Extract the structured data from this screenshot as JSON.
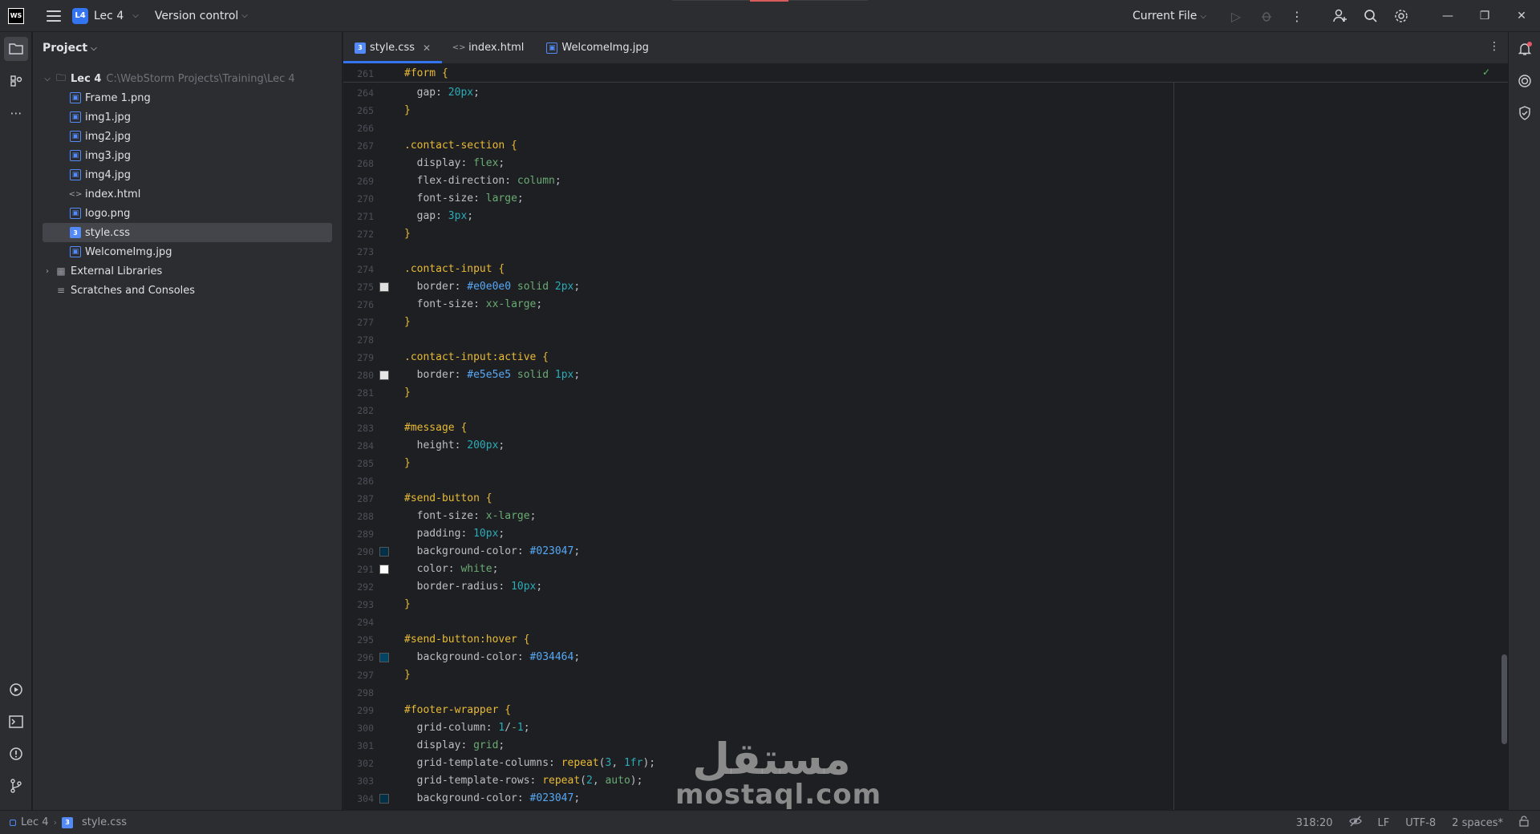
{
  "titlebar": {
    "logo_text": "WS",
    "project_badge": "L4",
    "project_name": "Lec 4",
    "vcs_label": "Version control",
    "run_config": "Current File"
  },
  "project_panel": {
    "title": "Project",
    "root_name": "Lec 4",
    "root_path": "C:\\WebStorm Projects\\Training\\Lec 4",
    "files": [
      {
        "name": "Frame 1.png",
        "kind": "img"
      },
      {
        "name": "img1.jpg",
        "kind": "img"
      },
      {
        "name": "img2.jpg",
        "kind": "img"
      },
      {
        "name": "img3.jpg",
        "kind": "img"
      },
      {
        "name": "img4.jpg",
        "kind": "img"
      },
      {
        "name": "index.html",
        "kind": "html"
      },
      {
        "name": "logo.png",
        "kind": "img"
      },
      {
        "name": "style.css",
        "kind": "css",
        "selected": true
      },
      {
        "name": "WelcomeImg.jpg",
        "kind": "img"
      }
    ],
    "external_libraries": "External Libraries",
    "scratches": "Scratches and Consoles"
  },
  "tabs": [
    {
      "label": "style.css",
      "kind": "css",
      "active": true
    },
    {
      "label": "index.html",
      "kind": "html"
    },
    {
      "label": "WelcomeImg.jpg",
      "kind": "img"
    }
  ],
  "editor": {
    "sticky_line": {
      "num": "261",
      "text": "#form {"
    },
    "lines": [
      {
        "n": "264",
        "t": "  gap: 20px;"
      },
      {
        "n": "265",
        "t": "}"
      },
      {
        "n": "266",
        "t": ""
      },
      {
        "n": "267",
        "t": ".contact-section {"
      },
      {
        "n": "268",
        "t": "  display: flex;"
      },
      {
        "n": "269",
        "t": "  flex-direction: column;"
      },
      {
        "n": "270",
        "t": "  font-size: large;"
      },
      {
        "n": "271",
        "t": "  gap: 3px;"
      },
      {
        "n": "272",
        "t": "}"
      },
      {
        "n": "273",
        "t": ""
      },
      {
        "n": "274",
        "t": ".contact-input {"
      },
      {
        "n": "275",
        "t": "  border: #e0e0e0 solid 2px;",
        "swatch": "#e0e0e0"
      },
      {
        "n": "276",
        "t": "  font-size: xx-large;"
      },
      {
        "n": "277",
        "t": "}"
      },
      {
        "n": "278",
        "t": ""
      },
      {
        "n": "279",
        "t": ".contact-input:active {"
      },
      {
        "n": "280",
        "t": "  border: #e5e5e5 solid 1px;",
        "swatch": "#e5e5e5"
      },
      {
        "n": "281",
        "t": "}"
      },
      {
        "n": "282",
        "t": ""
      },
      {
        "n": "283",
        "t": "#message {"
      },
      {
        "n": "284",
        "t": "  height: 200px;"
      },
      {
        "n": "285",
        "t": "}"
      },
      {
        "n": "286",
        "t": ""
      },
      {
        "n": "287",
        "t": "#send-button {"
      },
      {
        "n": "288",
        "t": "  font-size: x-large;"
      },
      {
        "n": "289",
        "t": "  padding: 10px;"
      },
      {
        "n": "290",
        "t": "  background-color: #023047;",
        "swatch": "#023047"
      },
      {
        "n": "291",
        "t": "  color: white;",
        "swatch": "#ffffff"
      },
      {
        "n": "292",
        "t": "  border-radius: 10px;"
      },
      {
        "n": "293",
        "t": "}"
      },
      {
        "n": "294",
        "t": ""
      },
      {
        "n": "295",
        "t": "#send-button:hover {"
      },
      {
        "n": "296",
        "t": "  background-color: #034464;",
        "swatch": "#034464"
      },
      {
        "n": "297",
        "t": "}"
      },
      {
        "n": "298",
        "t": ""
      },
      {
        "n": "299",
        "t": "#footer-wrapper {"
      },
      {
        "n": "300",
        "t": "  grid-column: 1/-1;"
      },
      {
        "n": "301",
        "t": "  display: grid;"
      },
      {
        "n": "302",
        "t": "  grid-template-columns: repeat(3, 1fr);"
      },
      {
        "n": "303",
        "t": "  grid-template-rows: repeat(2, auto);"
      },
      {
        "n": "304",
        "t": "  background-color: #023047;",
        "swatch": "#023047"
      }
    ]
  },
  "watermark": {
    "arabic": "مستقل",
    "latin": "mostaql.com"
  },
  "statusbar": {
    "breadcrumb_project": "Lec 4",
    "breadcrumb_file": "style.css",
    "position": "318:20",
    "line_ending": "LF",
    "encoding": "UTF-8",
    "indent": "2 spaces*"
  },
  "colors": {
    "accent": "#3574f0",
    "selector": "#e8ba36",
    "value": "#6aab73",
    "number": "#2aacb8",
    "hex": "#56a8f5"
  }
}
